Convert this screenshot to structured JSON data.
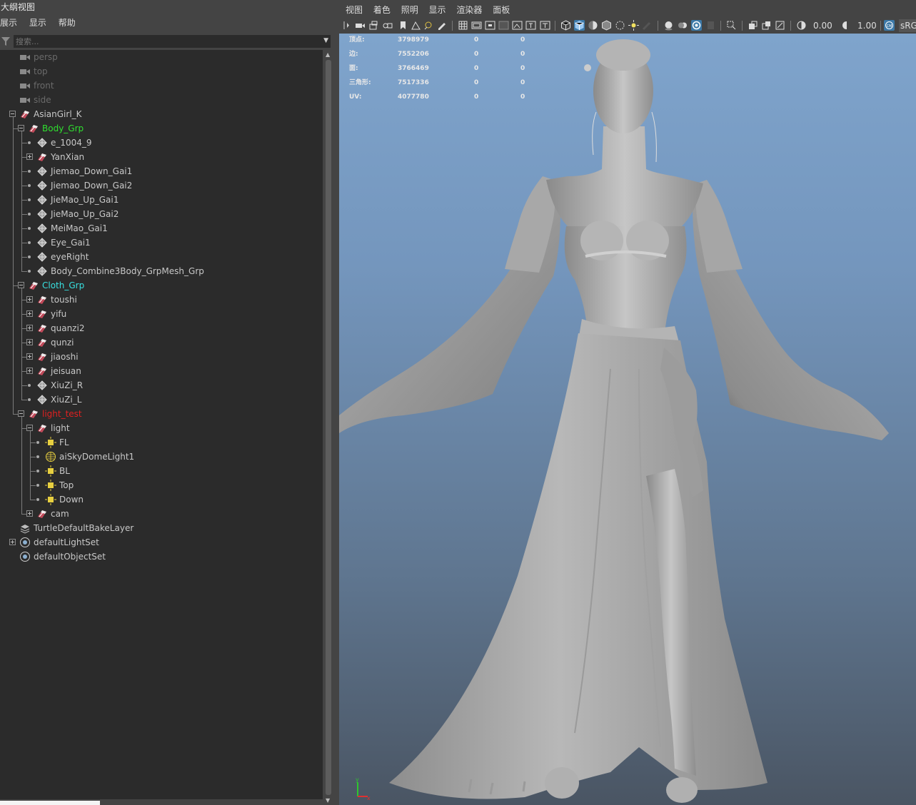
{
  "outliner": {
    "title": "大纲视图",
    "menu": [
      "展示",
      "显示",
      "帮助"
    ],
    "search_placeholder": "搜索...",
    "items": [
      {
        "label": "persp",
        "color": "#6a6a6a",
        "icon": "camera-icon"
      },
      {
        "label": "top",
        "color": "#6a6a6a",
        "icon": "camera-icon"
      },
      {
        "label": "front",
        "color": "#6a6a6a",
        "icon": "camera-icon"
      },
      {
        "label": "side",
        "color": "#6a6a6a",
        "icon": "camera-icon"
      },
      {
        "label": "AsianGirl_K",
        "color": "#c8c8c8",
        "icon": "group-icon"
      },
      {
        "label": "Body_Grp",
        "color": "#2fe02f",
        "icon": "group-icon"
      },
      {
        "label": "e_1004_9",
        "color": "#c8c8c8",
        "icon": "mesh-icon"
      },
      {
        "label": "YanXian",
        "color": "#c8c8c8",
        "icon": "group-icon"
      },
      {
        "label": "Jiemao_Down_Gai1",
        "color": "#c8c8c8",
        "icon": "mesh-icon"
      },
      {
        "label": "Jiemao_Down_Gai2",
        "color": "#c8c8c8",
        "icon": "mesh-icon"
      },
      {
        "label": "JieMao_Up_Gai1",
        "color": "#c8c8c8",
        "icon": "mesh-icon"
      },
      {
        "label": "JieMao_Up_Gai2",
        "color": "#c8c8c8",
        "icon": "mesh-icon"
      },
      {
        "label": "MeiMao_Gai1",
        "color": "#c8c8c8",
        "icon": "mesh-icon"
      },
      {
        "label": "Eye_Gai1",
        "color": "#c8c8c8",
        "icon": "mesh-icon"
      },
      {
        "label": "eyeRight",
        "color": "#c8c8c8",
        "icon": "mesh-icon"
      },
      {
        "label": "Body_Combine3Body_GrpMesh_Grp",
        "color": "#c8c8c8",
        "icon": "mesh-icon"
      },
      {
        "label": "Cloth_Grp",
        "color": "#38e0e0",
        "icon": "group-icon"
      },
      {
        "label": "toushi",
        "color": "#c8c8c8",
        "icon": "group-icon"
      },
      {
        "label": "yifu",
        "color": "#c8c8c8",
        "icon": "group-icon"
      },
      {
        "label": "quanzi2",
        "color": "#c8c8c8",
        "icon": "group-icon"
      },
      {
        "label": "qunzi",
        "color": "#c8c8c8",
        "icon": "group-icon"
      },
      {
        "label": "jiaoshi",
        "color": "#c8c8c8",
        "icon": "group-icon"
      },
      {
        "label": "jeisuan",
        "color": "#c8c8c8",
        "icon": "group-icon"
      },
      {
        "label": "XiuZi_R",
        "color": "#c8c8c8",
        "icon": "mesh-icon"
      },
      {
        "label": "XiuZi_L",
        "color": "#c8c8c8",
        "icon": "mesh-icon"
      },
      {
        "label": "light_test",
        "color": "#e02020",
        "icon": "group-icon"
      },
      {
        "label": "light",
        "color": "#c8c8c8",
        "icon": "group-icon"
      },
      {
        "label": "FL",
        "color": "#c8c8c8",
        "icon": "light-icon"
      },
      {
        "label": "aiSkyDomeLight1",
        "color": "#c8c8c8",
        "icon": "skydome-icon"
      },
      {
        "label": "BL",
        "color": "#c8c8c8",
        "icon": "light-icon"
      },
      {
        "label": "Top",
        "color": "#c8c8c8",
        "icon": "light-icon"
      },
      {
        "label": "Down",
        "color": "#c8c8c8",
        "icon": "light-icon"
      },
      {
        "label": "cam",
        "color": "#c8c8c8",
        "icon": "group-icon"
      },
      {
        "label": "TurtleDefaultBakeLayer",
        "color": "#c8c8c8",
        "icon": "bake-layer-icon"
      },
      {
        "label": "defaultLightSet",
        "color": "#c8c8c8",
        "icon": "set-icon"
      },
      {
        "label": "defaultObjectSet",
        "color": "#c8c8c8",
        "icon": "set-icon"
      }
    ]
  },
  "viewport": {
    "menu": [
      "视图",
      "着色",
      "照明",
      "显示",
      "渲染器",
      "面板"
    ],
    "toolbar": {
      "exposure": "0.00",
      "gamma": "1.00",
      "colorspace": "sRG"
    },
    "hud": [
      {
        "label": "顶点:",
        "value": "3798979",
        "a": "0",
        "b": "0"
      },
      {
        "label": "边:",
        "value": "7552206",
        "a": "0",
        "b": "0"
      },
      {
        "label": "面:",
        "value": "3766469",
        "a": "0",
        "b": "0"
      },
      {
        "label": "三角形:",
        "value": "7517336",
        "a": "0",
        "b": "0"
      },
      {
        "label": "UV:",
        "value": "4077780",
        "a": "0",
        "b": "0"
      }
    ],
    "axis": {
      "y": "y",
      "x": "x"
    }
  }
}
